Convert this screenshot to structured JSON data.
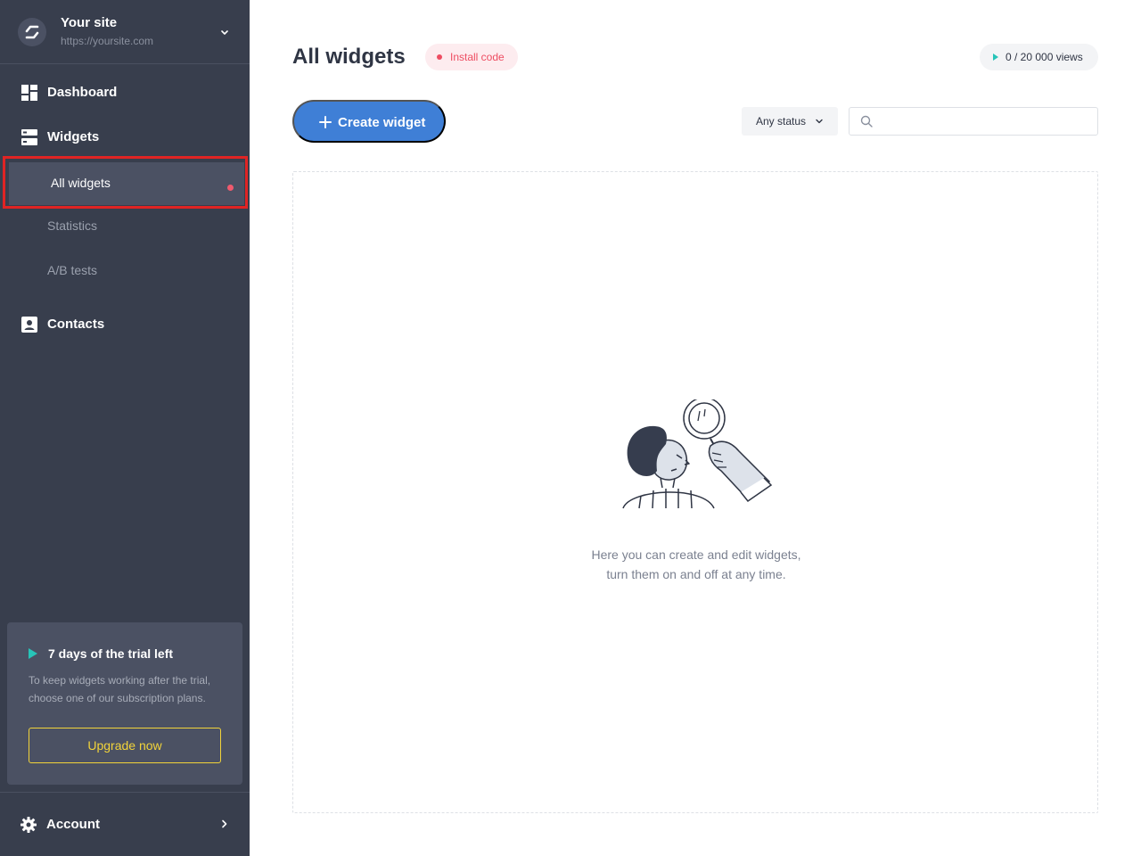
{
  "site": {
    "name": "Your site",
    "url": "https://yoursite.com"
  },
  "nav": {
    "dashboard": "Dashboard",
    "widgets": "Widgets",
    "sub": {
      "all_widgets": "All widgets",
      "statistics": "Statistics",
      "ab_tests": "A/B tests"
    },
    "contacts": "Contacts"
  },
  "trial": {
    "title": "7 days of the trial left",
    "text": "To keep widgets working after the trial, choose one of our subscription plans.",
    "upgrade_label": "Upgrade now"
  },
  "account": {
    "label": "Account"
  },
  "header": {
    "title": "All widgets",
    "install_label": "Install code",
    "views_label": "0 / 20 000 views"
  },
  "toolbar": {
    "create_label": "Create widget",
    "status_label": "Any status",
    "search_placeholder": ""
  },
  "empty": {
    "line1": "Here you can create and edit widgets,",
    "line2": "turn them on and off at any time."
  },
  "colors": {
    "sidebar_bg": "#383e4d",
    "accent_blue": "#3f7fd6",
    "alert_pink": "#ee4d62",
    "teal": "#27c4b8",
    "upgrade_yellow": "#f2d43a"
  }
}
